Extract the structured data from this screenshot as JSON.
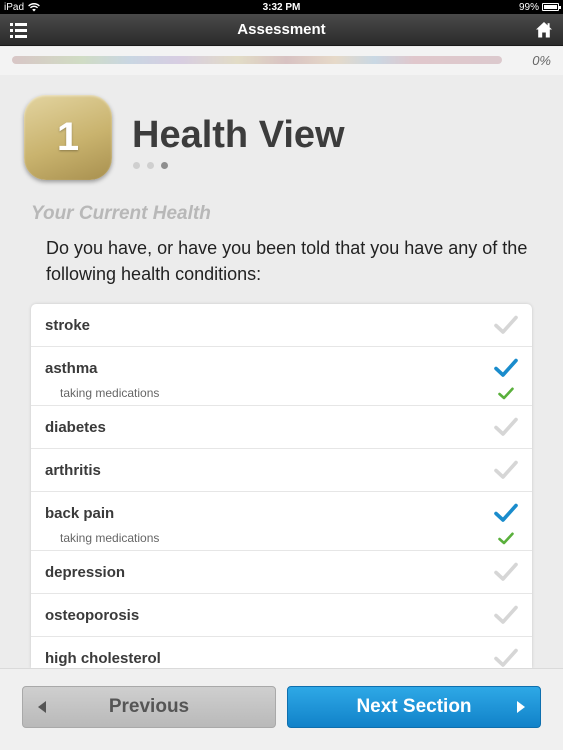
{
  "status_bar": {
    "device": "iPad",
    "time": "3:32 PM",
    "battery": "99%"
  },
  "nav": {
    "title": "Assessment",
    "menu_icon": "list-icon",
    "home_icon": "home-icon"
  },
  "progress": {
    "percent_label": "0%",
    "value": 0
  },
  "section": {
    "number": "1",
    "title": "Health View",
    "page_count": 3,
    "current_page": 3
  },
  "subheading": "Your Current Health",
  "question": "Do you have, or have you been told that you have any of the following health conditions:",
  "conditions": [
    {
      "label": "stroke",
      "checked": false
    },
    {
      "label": "asthma",
      "checked": true,
      "sub_label": "taking medications",
      "sub_checked": true
    },
    {
      "label": "diabetes",
      "checked": false
    },
    {
      "label": "arthritis",
      "checked": false
    },
    {
      "label": "back pain",
      "checked": true,
      "sub_label": "taking medications",
      "sub_checked": true
    },
    {
      "label": "depression",
      "checked": false
    },
    {
      "label": "osteoporosis",
      "checked": false
    },
    {
      "label": "high cholesterol",
      "checked": false
    }
  ],
  "buttons": {
    "previous": "Previous",
    "next": "Next Section"
  },
  "colors": {
    "check_selected": "#1a8ccc",
    "check_sub": "#5ab03c",
    "check_unselected": "#d6d6d6",
    "next_button": "#1a95d8",
    "badge_gold": "#c9b36e"
  }
}
